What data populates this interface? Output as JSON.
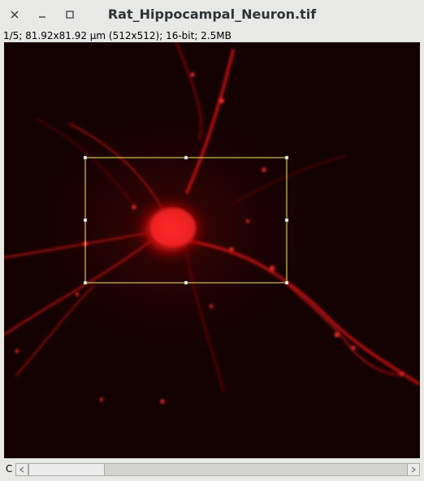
{
  "window": {
    "title": "Rat_Hippocampal_Neuron.tif",
    "controls": [
      "close-icon",
      "minimize-icon",
      "maximize-icon"
    ]
  },
  "info": {
    "text": "1/5; 81.92x81.92 µm (512x512); 16-bit; 2.5MB"
  },
  "image": {
    "subject": "neuron-fluorescence",
    "colormap": "red",
    "selection_color": "#f2ec6b"
  },
  "slider": {
    "channel_label": "C",
    "position": 0.2
  },
  "colors": {
    "background": "#140202",
    "signal": "#ff2020",
    "chrome": "#e8e8e7"
  }
}
